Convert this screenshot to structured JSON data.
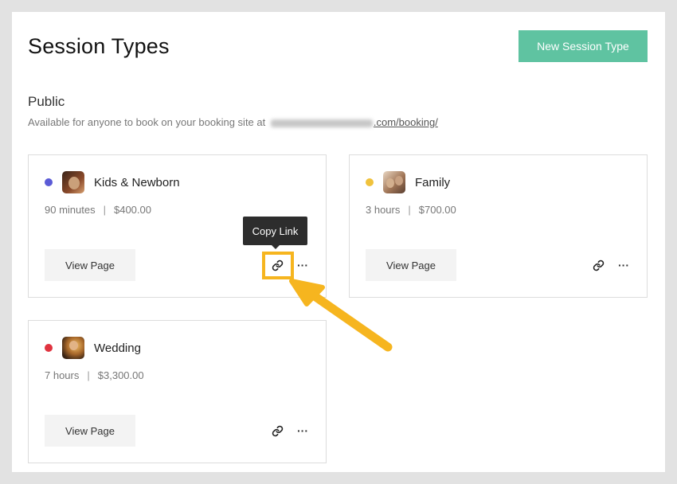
{
  "header": {
    "title": "Session Types",
    "new_button": "New Session Type"
  },
  "section": {
    "title": "Public",
    "description_prefix": "Available for anyone to book on your booking site at",
    "description_link": ".com/booking/"
  },
  "cards": [
    {
      "name": "Kids & Newborn",
      "duration": "90 minutes",
      "separator": "|",
      "price": "$400.00",
      "view_label": "View Page",
      "dot_color": "#5b5bd6"
    },
    {
      "name": "Family",
      "duration": "3 hours",
      "separator": "|",
      "price": "$700.00",
      "view_label": "View Page",
      "dot_color": "#f0c23c"
    },
    {
      "name": "Wedding",
      "duration": "7 hours",
      "separator": "|",
      "price": "$3,300.00",
      "view_label": "View Page",
      "dot_color": "#e0333f"
    }
  ],
  "tooltip": {
    "text": "Copy Link"
  },
  "colors": {
    "accent": "#5fc3a1",
    "highlight": "#f6b51f"
  },
  "icons": {
    "link": "link-icon",
    "more": "more-icon"
  },
  "more_glyph": "···"
}
